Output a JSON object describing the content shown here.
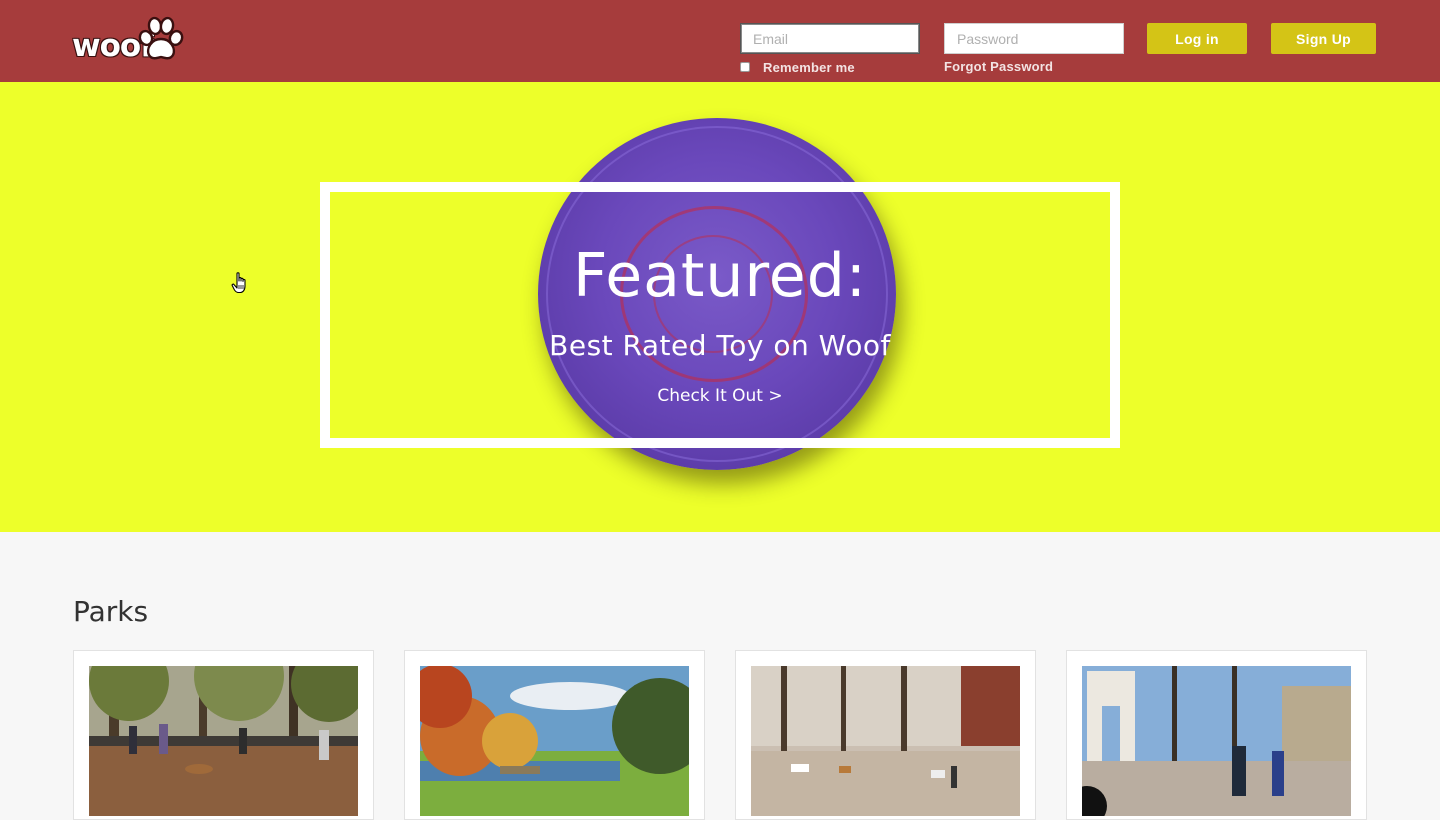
{
  "header": {
    "logo_text": "woof",
    "email_placeholder": "Email",
    "password_placeholder": "Password",
    "remember_label": "Remember me",
    "forgot_label": "Forgot Password",
    "login_label": "Log in",
    "signup_label": "Sign Up"
  },
  "hero": {
    "title": "Featured:",
    "subtitle": "Best Rated Toy on Woof",
    "cta": "Check It Out >"
  },
  "parks": {
    "heading": "Parks",
    "cards": [
      {
        "image": "dog-park-photo"
      },
      {
        "image": "autumn-lake-park-photo"
      },
      {
        "image": "winter-dog-run-photo"
      },
      {
        "image": "washington-square-arch-photo"
      }
    ]
  },
  "colors": {
    "header_bg": "#a63c3c",
    "hero_bg": "#edff2a",
    "button_bg": "#d4c416",
    "frisbee": "#6a48bb"
  }
}
